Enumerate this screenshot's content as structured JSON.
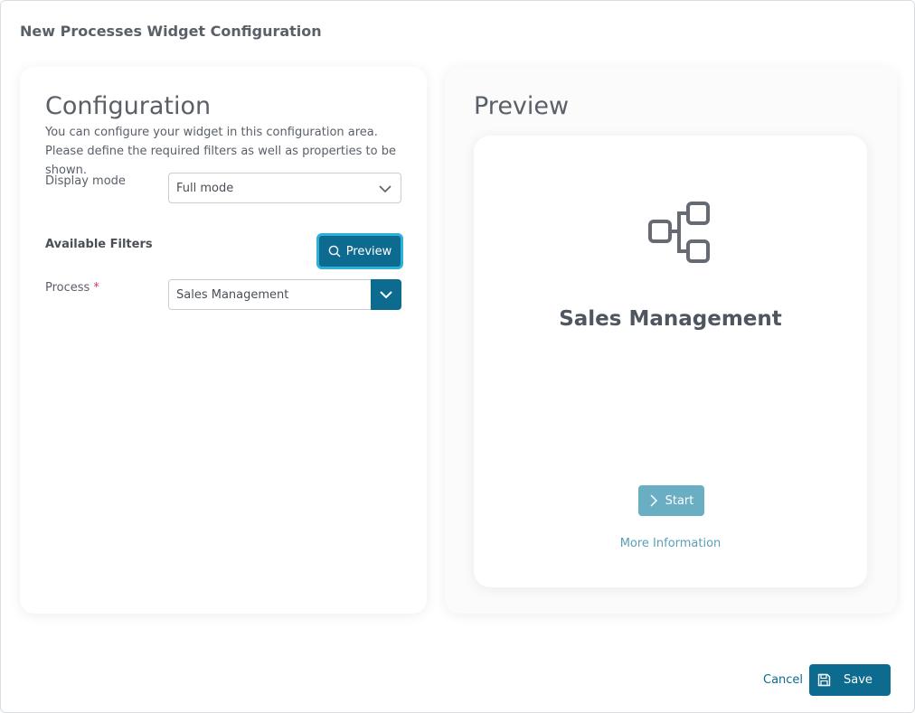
{
  "dialog": {
    "title": "New Processes Widget Configuration"
  },
  "config": {
    "heading": "Configuration",
    "description": "You can configure your widget in this configuration area. Please define the required filters as well as properties to be shown.",
    "display_mode": {
      "label": "Display mode",
      "value": "Full mode",
      "icon": "chevron-down-icon"
    },
    "filters": {
      "title": "Available Filters",
      "preview_button": "Preview",
      "preview_icon": "search-icon"
    },
    "process": {
      "label": "Process",
      "required_marker": "*",
      "value": "Sales Management",
      "icon": "chevron-down-icon"
    }
  },
  "preview": {
    "heading": "Preview",
    "card": {
      "icon": "process-flow-icon",
      "title": "Sales Management",
      "start_button": "Start",
      "start_icon": "chevron-right-icon",
      "more_info_link": "More Information"
    }
  },
  "footer": {
    "cancel_label": "Cancel",
    "save_label": "Save",
    "save_icon": "floppy-disk-icon"
  },
  "colors": {
    "accent": "#0c6b8e",
    "focus_ring": "#2fb0d6",
    "start_button": "#6aaec3",
    "link": "#5a9fb7",
    "required": "#d6336c"
  }
}
